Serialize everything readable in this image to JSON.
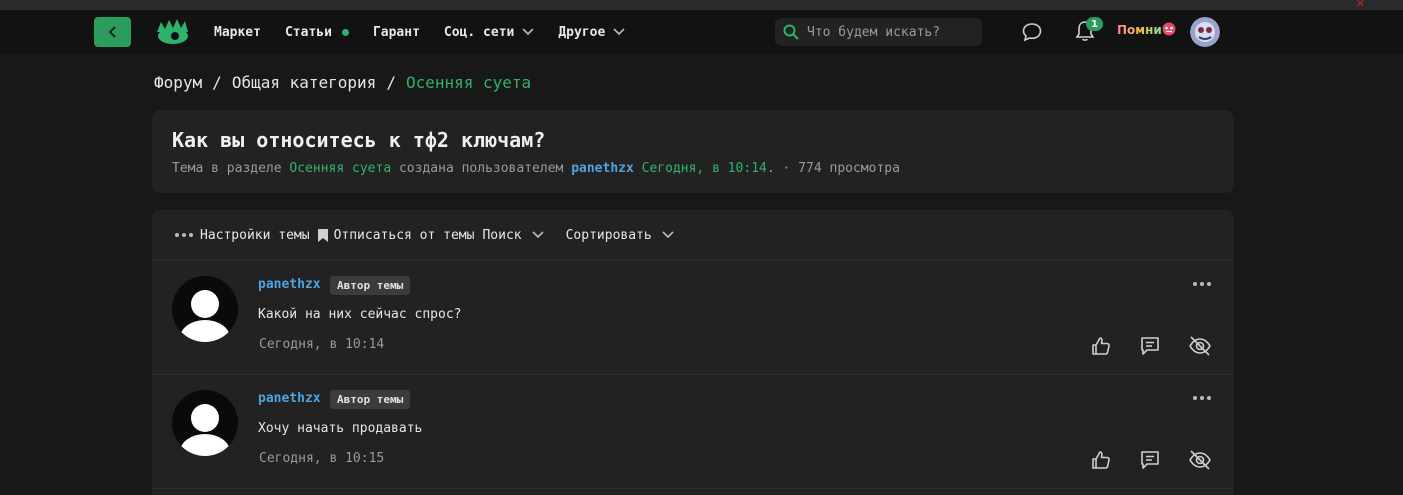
{
  "nav": {
    "menu": [
      {
        "label": "Маркет"
      },
      {
        "label": "Статьи"
      },
      {
        "label": "Гарант"
      },
      {
        "label": "Соц. сети"
      },
      {
        "label": "Другое"
      }
    ],
    "search_placeholder": "Что будем искать?",
    "notification_count": "1",
    "username": "Помни"
  },
  "breadcrumbs": {
    "root": "Форум",
    "sep": "/",
    "category": "Общая категория",
    "current": "Осенняя суета"
  },
  "thread": {
    "title": "Как вы относитесь к тф2 ключам?",
    "meta_prefix": "Тема в разделе",
    "section": "Осенняя суета",
    "meta_mid": "создана пользователем",
    "author": "panethzx",
    "created": "Сегодня, в 10:14",
    "views": "· 774 просмотра"
  },
  "toolbar": {
    "settings": "Настройки темы",
    "unsubscribe": "Отписаться от темы",
    "search": "Поиск",
    "sort": "Сортировать"
  },
  "posts": [
    {
      "author": "panethzx",
      "role": "Автор темы",
      "text": "Какой на них сейчас спрос?",
      "time": "Сегодня, в 10:14"
    },
    {
      "author": "panethzx",
      "role": "Автор темы",
      "text": "Хочу начать продавать",
      "time": "Сегодня, в 10:15"
    }
  ],
  "colors": {
    "accent": "#2fb26b",
    "link": "#4fa3e0",
    "background": "#181818",
    "card": "#222222"
  },
  "icons": [
    "back-arrow-icon",
    "logo-icon",
    "chevron-down-icon",
    "search-icon",
    "chat-icon",
    "bell-icon",
    "avatar-icon",
    "more-icon",
    "like-icon",
    "quote-icon",
    "hide-icon",
    "bookmark-icon"
  ]
}
